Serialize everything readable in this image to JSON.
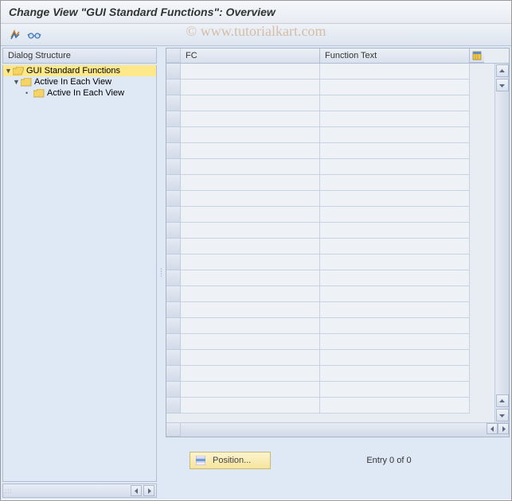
{
  "title": "Change View \"GUI Standard Functions\": Overview",
  "watermark": "© www.tutorialkart.com",
  "sidebar": {
    "header": "Dialog Structure",
    "items": [
      {
        "label": "GUI Standard Functions",
        "selected": true,
        "expanded": true
      },
      {
        "label": "Active In Each View",
        "selected": false,
        "expanded": true
      },
      {
        "label": "Active In Each View",
        "selected": false,
        "expanded": false
      }
    ]
  },
  "table": {
    "columns": {
      "fc": "FC",
      "ft": "Function Text"
    },
    "row_count": 22
  },
  "footer": {
    "position_label": "Position...",
    "entry_status": "Entry 0 of 0"
  },
  "icons": {
    "toggle": "toggle-icon",
    "glasses": "glasses-icon",
    "folder_open": "folder-open-icon",
    "folder_closed": "folder-closed-icon",
    "config": "table-config-icon",
    "scroll_up": "▲",
    "scroll_down": "▼",
    "scroll_left": "◀",
    "scroll_right": "▶"
  }
}
